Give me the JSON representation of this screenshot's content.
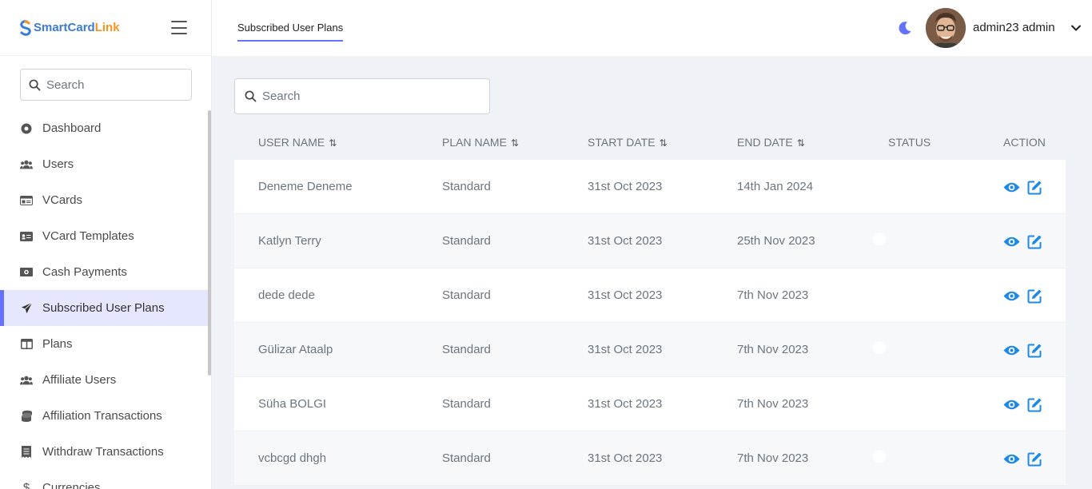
{
  "brand": {
    "name_part1": "SmartCard",
    "name_part2": "Link"
  },
  "sidebar": {
    "search_placeholder": "Search",
    "items": [
      {
        "label": "Dashboard",
        "icon": "dashboard-icon"
      },
      {
        "label": "Users",
        "icon": "users-icon"
      },
      {
        "label": "VCards",
        "icon": "vcard-icon"
      },
      {
        "label": "VCard Templates",
        "icon": "vcard-template-icon"
      },
      {
        "label": "Cash Payments",
        "icon": "cash-icon"
      },
      {
        "label": "Subscribed User Plans",
        "icon": "paper-plane-icon",
        "active": true
      },
      {
        "label": "Plans",
        "icon": "plans-icon"
      },
      {
        "label": "Affiliate Users",
        "icon": "affiliate-users-icon"
      },
      {
        "label": "Affiliation Transactions",
        "icon": "coins-icon"
      },
      {
        "label": "Withdraw Transactions",
        "icon": "receipt-icon"
      },
      {
        "label": "Currencies",
        "icon": "dollar-icon"
      }
    ]
  },
  "header": {
    "tab_label": "Subscribed User Plans",
    "username": "admin23 admin"
  },
  "main": {
    "search_placeholder": "Search",
    "columns": [
      "USER NAME",
      "PLAN NAME",
      "START DATE",
      "END DATE",
      "STATUS",
      "ACTION"
    ],
    "rows": [
      {
        "user": "Deneme Deneme",
        "plan": "Standard",
        "start": "31st Oct 2023",
        "end": "14th Jan 2024",
        "status": true
      },
      {
        "user": "Katlyn Terry",
        "plan": "Standard",
        "start": "31st Oct 2023",
        "end": "25th Nov 2023",
        "status": true
      },
      {
        "user": "dede dede",
        "plan": "Standard",
        "start": "31st Oct 2023",
        "end": "7th Nov 2023",
        "status": true
      },
      {
        "user": "Gülizar Ataalp",
        "plan": "Standard",
        "start": "31st Oct 2023",
        "end": "7th Nov 2023",
        "status": true
      },
      {
        "user": "Süha BOLGI",
        "plan": "Standard",
        "start": "31st Oct 2023",
        "end": "7th Nov 2023",
        "status": true
      },
      {
        "user": "vcbcgd dhgh",
        "plan": "Standard",
        "start": "31st Oct 2023",
        "end": "7th Nov 2023",
        "status": true
      }
    ]
  },
  "colors": {
    "accent": "#6571ff",
    "action_blue": "#1e88e5",
    "toggle": "#a7adf5"
  }
}
